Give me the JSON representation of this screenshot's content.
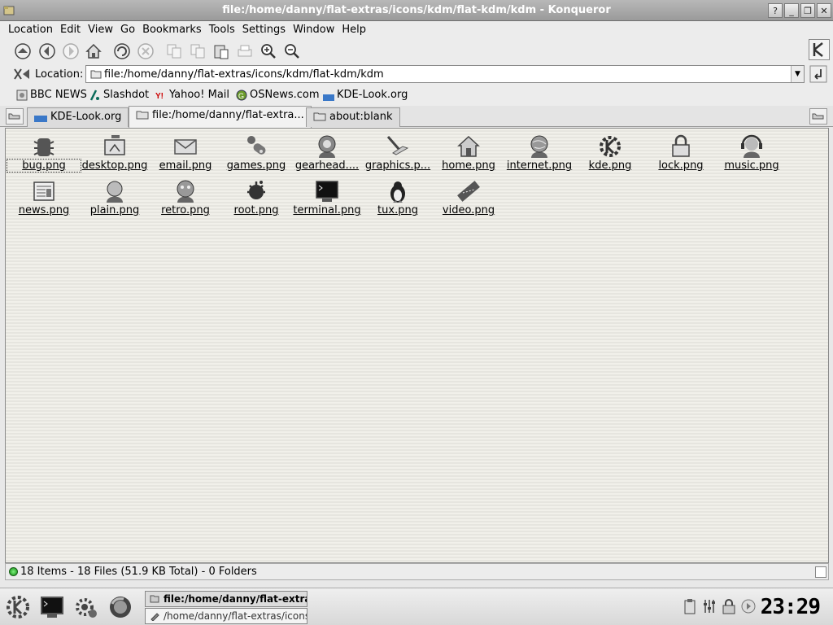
{
  "window": {
    "title": "file:/home/danny/flat-extras/icons/kdm/flat-kdm/kdm - Konqueror",
    "buttons": [
      "?",
      "_",
      "❐",
      "✕"
    ]
  },
  "menubar": {
    "items": [
      "Location",
      "Edit",
      "View",
      "Go",
      "Bookmarks",
      "Tools",
      "Settings",
      "Window",
      "Help"
    ]
  },
  "toolbar": {
    "icons": [
      "up-icon",
      "back-icon",
      "forward-icon",
      "home-icon",
      "reload-icon",
      "stop-icon",
      "cut-icon",
      "copy-icon",
      "paste-icon",
      "print-icon",
      "zoom-in-icon",
      "zoom-out-icon"
    ]
  },
  "location": {
    "label": "Location:",
    "value": "file:/home/danny/flat-extras/icons/kdm/flat-kdm/kdm"
  },
  "bookmarks": [
    "BBC NEWS",
    "Slashdot",
    "Yahoo! Mail",
    "OSNews.com",
    "KDE-Look.org"
  ],
  "tabs": [
    {
      "label": "KDE-Look.org",
      "active": false
    },
    {
      "label": "file:/home/danny/flat-extra...",
      "active": true
    },
    {
      "label": "about:blank",
      "active": false
    }
  ],
  "files": [
    "bug.png",
    "desktop.png",
    "email.png",
    "games.png",
    "gearhead....",
    "graphics.p...",
    "home.png",
    "internet.png",
    "kde.png",
    "lock.png",
    "music.png",
    "news.png",
    "plain.png",
    "retro.png",
    "root.png",
    "terminal.png",
    "tux.png",
    "video.png"
  ],
  "status": {
    "text": "18 Items - 18 Files (51.9 KB Total) - 0 Folders"
  },
  "taskbar": {
    "tasks": [
      "file:/home/danny/flat-extra",
      "/home/danny/flat-extras/icons/"
    ],
    "clock": "23:29"
  }
}
